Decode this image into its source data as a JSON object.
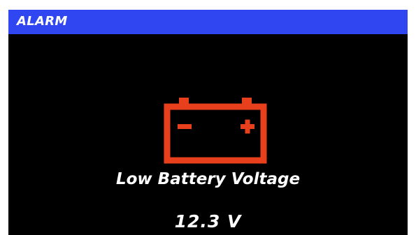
{
  "header": {
    "title": "ALARM",
    "color": "#2f46f0"
  },
  "alarm": {
    "icon": "battery-icon",
    "icon_color": "#e8401c",
    "message": "Low Battery Voltage",
    "value": "12.3 V"
  }
}
